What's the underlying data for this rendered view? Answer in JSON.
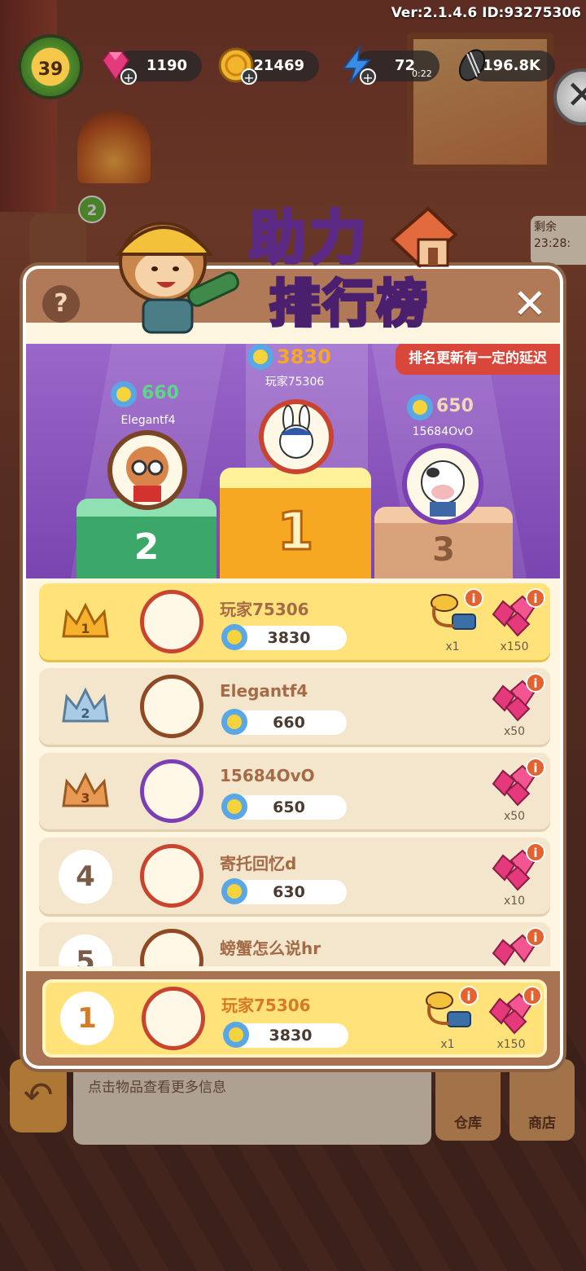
{
  "hud": {
    "version": "Ver:2.1.4.6 ID:93275306",
    "level": "39",
    "gems": "1190",
    "coins": "21469",
    "energy": "72",
    "energy_timer": "0:22",
    "seeds": "196.8K"
  },
  "background": {
    "badge_count": "2",
    "timer_label": "剩余",
    "timer_value": "23:28:",
    "info_text": "点击物品查看更多信息",
    "warehouse_label": "仓库",
    "shop_label": "商店"
  },
  "title": {
    "line1": "助力",
    "line2": "排行榜"
  },
  "notice": "排名更新有一定的延迟",
  "podium": [
    {
      "rank": "1",
      "name": "玩家75306",
      "score": "3830"
    },
    {
      "rank": "2",
      "name": "Elegantf4",
      "score": "660"
    },
    {
      "rank": "3",
      "name": "15684OvO",
      "score": "650"
    }
  ],
  "rows": [
    {
      "rank": "1",
      "name": "玩家75306",
      "score": "3830",
      "rewards": [
        "x1",
        "x150"
      ]
    },
    {
      "rank": "2",
      "name": "Elegantf4",
      "score": "660",
      "rewards": [
        "x50"
      ]
    },
    {
      "rank": "3",
      "name": "15684OvO",
      "score": "650",
      "rewards": [
        "x50"
      ]
    },
    {
      "rank": "4",
      "name": "寄托回忆d",
      "score": "630",
      "rewards": [
        "x10"
      ]
    },
    {
      "rank": "5",
      "name": "螃蟹怎么说hr",
      "score": "",
      "rewards": []
    }
  ],
  "me": {
    "rank": "1",
    "name": "玩家75306",
    "score": "3830",
    "rewards": [
      "x1",
      "x150"
    ]
  },
  "icons": {
    "help": "?",
    "close": "✕",
    "info": "i",
    "plus": "+",
    "back": "↶"
  },
  "colors": {
    "podium_bg": "#8a55bf",
    "gold_row": "#ffe27a",
    "notice_red": "#d9473a",
    "name_brown": "#a46b46"
  }
}
